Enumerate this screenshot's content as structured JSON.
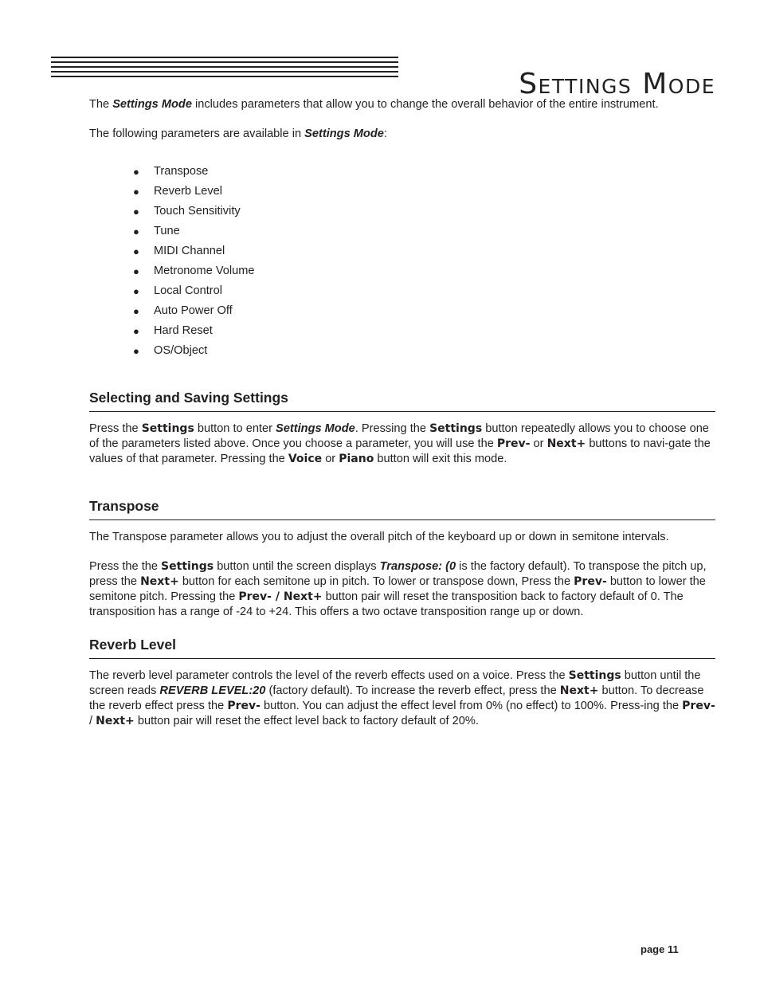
{
  "header": {
    "title": "Settings Mode"
  },
  "intro": {
    "p1": {
      "a": "The ",
      "em": "Settings Mode",
      "b": " includes parameters that allow you to change the overall behavior of the entire instrument."
    },
    "p2": {
      "a": "The following parameters are available in ",
      "em": "Settings Mode",
      "b": ":"
    }
  },
  "parameters": [
    "Transpose",
    "Reverb Level",
    "Touch Sensitivity",
    "Tune",
    "MIDI Channel",
    "Metronome Volume",
    "Local Control",
    "Auto Power Off",
    "Hard Reset",
    "OS/Object"
  ],
  "bullet": "●",
  "sections": {
    "selecting": {
      "heading": "Selecting and Saving Settings",
      "t": [
        "Press the ",
        "Settings",
        " button to enter ",
        "Settings Mode",
        ".  Pressing the ",
        "Settings",
        " button repeatedly allows you to choose one of the parameters listed above.  Once you choose a parameter, you will use the ",
        "Prev-",
        " or ",
        "Next+",
        " buttons to navi-gate the values of that parameter.  Pressing the ",
        "Voice",
        " or ",
        "Piano",
        " button will exit this mode."
      ]
    },
    "transpose": {
      "heading": "Transpose",
      "p1": "The Transpose parameter allows you to adjust the overall pitch of the keyboard up or down in semitone intervals.",
      "t": [
        "Press the the ",
        "Settings",
        " button until the screen displays ",
        "Transpose: (0",
        " is the factory default).  To transpose the pitch up, press the ",
        "Next+",
        " button for each semitone up in pitch.  To lower or transpose down, Press the ",
        "Prev-",
        " button to lower the semitone pitch. Pressing the ",
        "Prev- / Next+",
        " button pair will reset the transposition back to factory default of 0. The transposition has a range of -24 to +24. This offers a two octave transposition range up or down."
      ]
    },
    "reverb": {
      "heading": "Reverb Level",
      "t": [
        "The reverb level parameter controls the level of the reverb effects used on a voice.  Press the ",
        "Settings",
        " button until the screen reads ",
        "REVERB LEVEL:20",
        " (factory default).  To increase the reverb effect, press the ",
        "Next+",
        "  button. To decrease the reverb effect press the ",
        "Prev-",
        " button. You can adjust the effect level from 0% (no effect) to 100%. Press-ing the ",
        "Prev-",
        " / ",
        "Next+",
        " button pair will reset the effect level back to factory default of 20%."
      ]
    }
  },
  "footer": {
    "page": "page 11"
  }
}
